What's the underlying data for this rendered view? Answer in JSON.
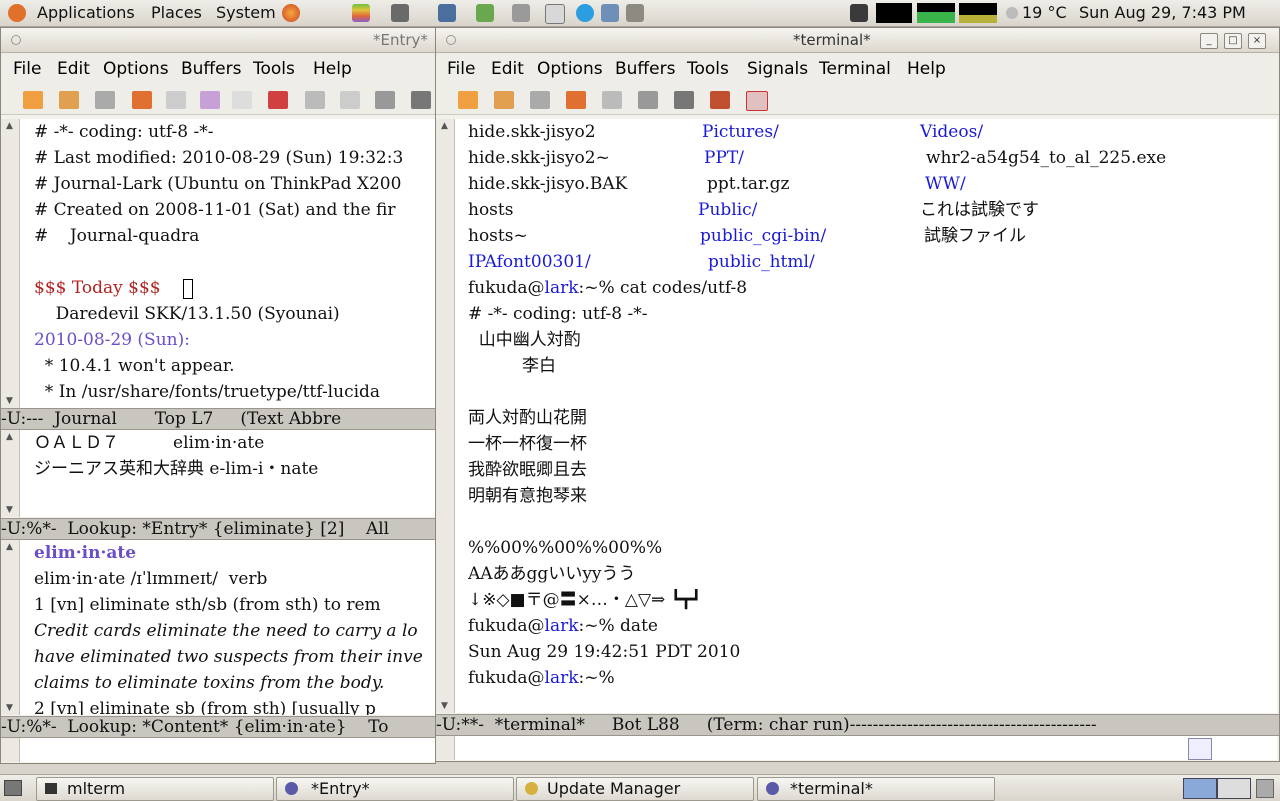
{
  "top_panel": {
    "menus": [
      "Applications",
      "Places",
      "System"
    ],
    "weather": "19 °C",
    "clock": "Sun Aug 29,  7:43 PM"
  },
  "entry_window": {
    "title": "*Entry*",
    "menu": [
      "File",
      "Edit",
      "Options",
      "Buffers",
      "Tools",
      "Help"
    ],
    "journal_lines": [
      "# -*- coding: utf-8 -*-",
      "# Last modified: 2010-08-29 (Sun) 19:32:3",
      "# Journal-Lark (Ubuntu on ThinkPad X200",
      "# Created on 2008-11-01 (Sat) and the fir",
      "#    Journal-quadra",
      "",
      "$$$ Today $$$ ",
      "    Daredevil SKK/13.1.50 (Syounai)",
      "2010-08-29 (Sun):",
      "  * 10.4.1 won't appear.",
      "  * In /usr/share/fonts/truetype/ttf-lucida"
    ],
    "journal_modeline": "-U:---  Journal       Top L7     (Text Abbre",
    "lookup_lines": [
      "ＯＡＬＤ７          elim·in·ate",
      "ジーニアス英和大辞典 e-lim-i・nate"
    ],
    "lookup_modeline": "-U:%*-  Lookup: *Entry* {eliminate} [2]    All",
    "content_lines": [
      "elim·in·ate",
      "elim·in·ate /ɪˈlɪmɪneɪt/  verb",
      "1 [vn] eliminate sth/sb (from sth) to rem",
      "Credit cards eliminate the need to carry a lo",
      "have eliminated two suspects from their inve",
      "claims to eliminate toxins from the body.",
      "2 [vn] eliminate sb (from sth) [usually p"
    ],
    "content_modeline": "-U:%*-  Lookup: *Content* {elim·in·ate}    To"
  },
  "terminal_window": {
    "title": "*terminal*",
    "menu": [
      "File",
      "Edit",
      "Options",
      "Buffers",
      "Tools",
      "Signals",
      "Terminal",
      "Help"
    ],
    "listing": [
      [
        "hide.skk-jisyo2",
        "Pictures/",
        "Videos/"
      ],
      [
        "hide.skk-jisyo2~",
        "PPT/",
        "whr2-a54g54_to_al_225.exe"
      ],
      [
        "hide.skk-jisyo.BAK",
        "ppt.tar.gz",
        "WW/"
      ],
      [
        "hosts",
        "Public/",
        "これは試験です"
      ],
      [
        "hosts~",
        "public_cgi-bin/",
        "試験ファイル"
      ],
      [
        "IPAfont00301/",
        "public_html/",
        ""
      ]
    ],
    "user": "fukuda",
    "host": "lark",
    "prompt_suffix": ":~% ",
    "cmd1": "cat codes/utf-8",
    "file_lines": [
      "# -*- coding: utf-8 -*-",
      "  山中幽人対酌",
      "          李白",
      "",
      "両人対酌山花開",
      "一杯一杯復一杯",
      "我酔欲眠卿且去",
      "明朝有意抱琴来",
      "",
      "%%00%%00%%00%%",
      "AAああggいいyyうう",
      "↓※◇■〒@〓×…・△▽⇒ ┗┳┛"
    ],
    "cmd2": "date",
    "date_output": "Sun Aug 29 19:42:51 PDT 2010",
    "modeline": "-U:**-  *terminal*     Bot L88     (Term: char run)-------------------------------------------"
  },
  "taskbar": {
    "items": [
      "mlterm",
      "*Entry*",
      "Update Manager",
      "*terminal*"
    ]
  }
}
